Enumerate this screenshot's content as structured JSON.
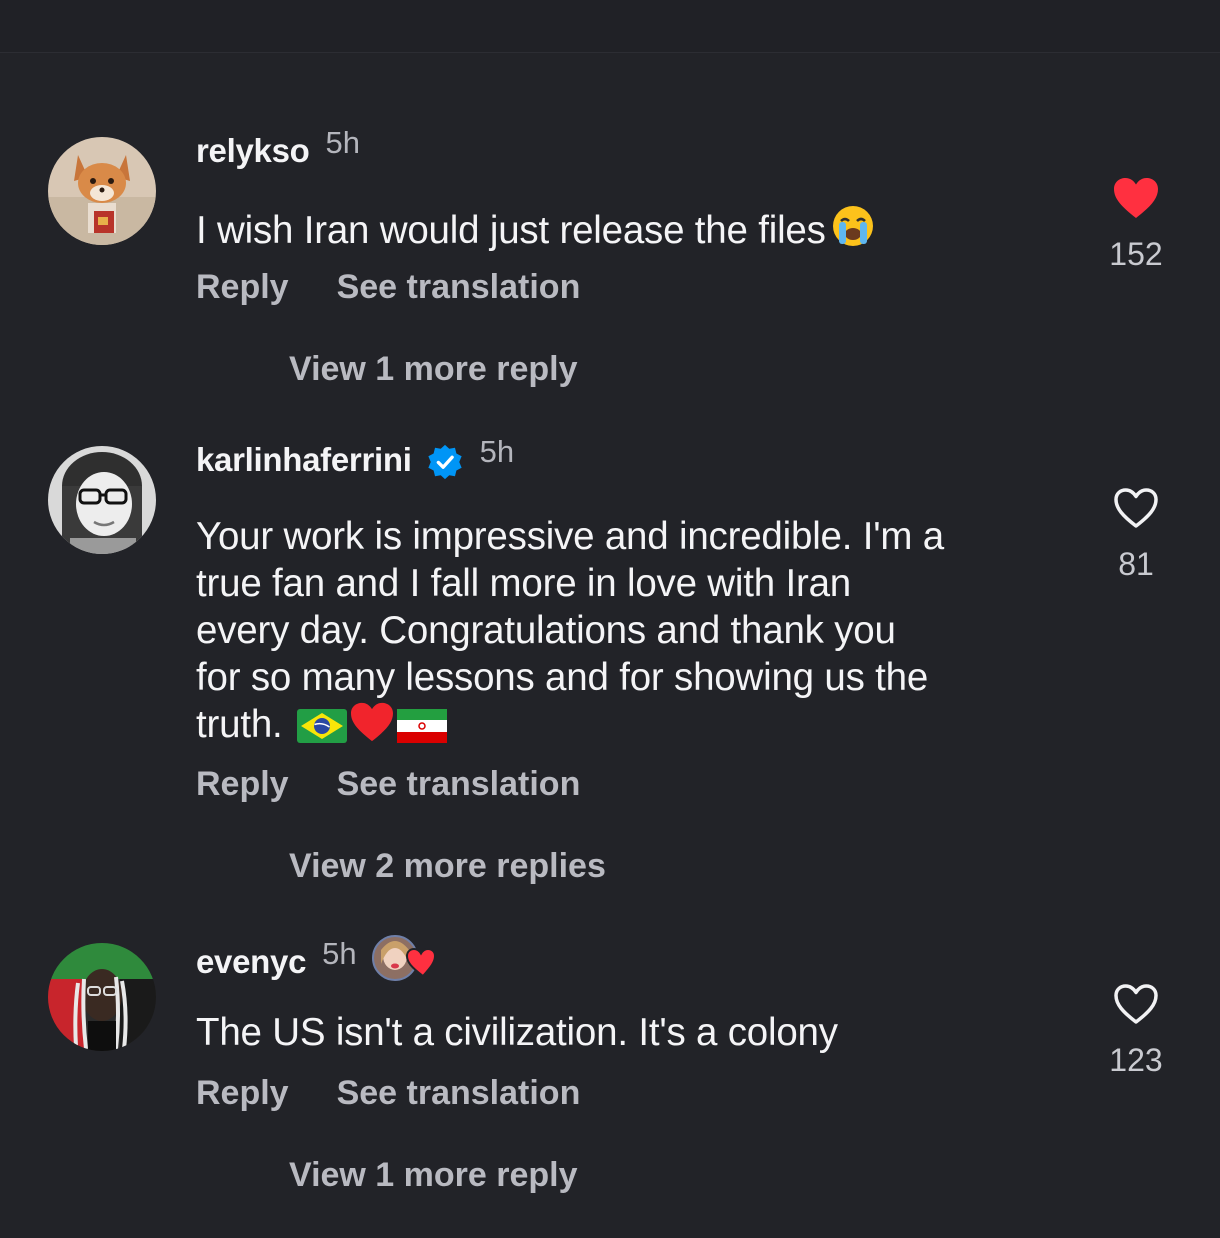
{
  "comments": [
    {
      "username": "relykso",
      "time": "5h",
      "text": "I wish Iran would just release the files",
      "emoji": "loudly-crying-face",
      "actions": {
        "reply": "Reply",
        "translate": "See translation"
      },
      "view_replies": "View 1 more reply",
      "likes": "152",
      "liked": true,
      "avatar": "fox-avatar"
    },
    {
      "username": "karlinhaferrini",
      "verified": true,
      "time": "5h",
      "text_lines": [
        "Your work is impressive and incredible. I'm a",
        "true fan and I fall more in love with Iran",
        "every day. Congratulations and thank you",
        "for so many lessons and for showing us the",
        "truth."
      ],
      "emojis": [
        "brazil-flag",
        "red-heart",
        "iran-flag"
      ],
      "actions": {
        "reply": "Reply",
        "translate": "See translation"
      },
      "view_replies": "View 2 more replies",
      "likes": "81",
      "liked": false,
      "avatar": "woman-glasses-avatar"
    },
    {
      "username": "evenyc",
      "time": "5h",
      "creator_liked": true,
      "text": "The US isn't a civilization. It's a colony",
      "actions": {
        "reply": "Reply",
        "translate": "See translation"
      },
      "view_replies": "View 1 more reply",
      "likes": "123",
      "liked": false,
      "avatar": "braids-avatar"
    }
  ],
  "colors": {
    "background": "#222328",
    "text": "#f4f4f6",
    "secondary_text": "#b9bac1",
    "like_red": "#ff3040",
    "verified_blue": "#0095f6"
  }
}
